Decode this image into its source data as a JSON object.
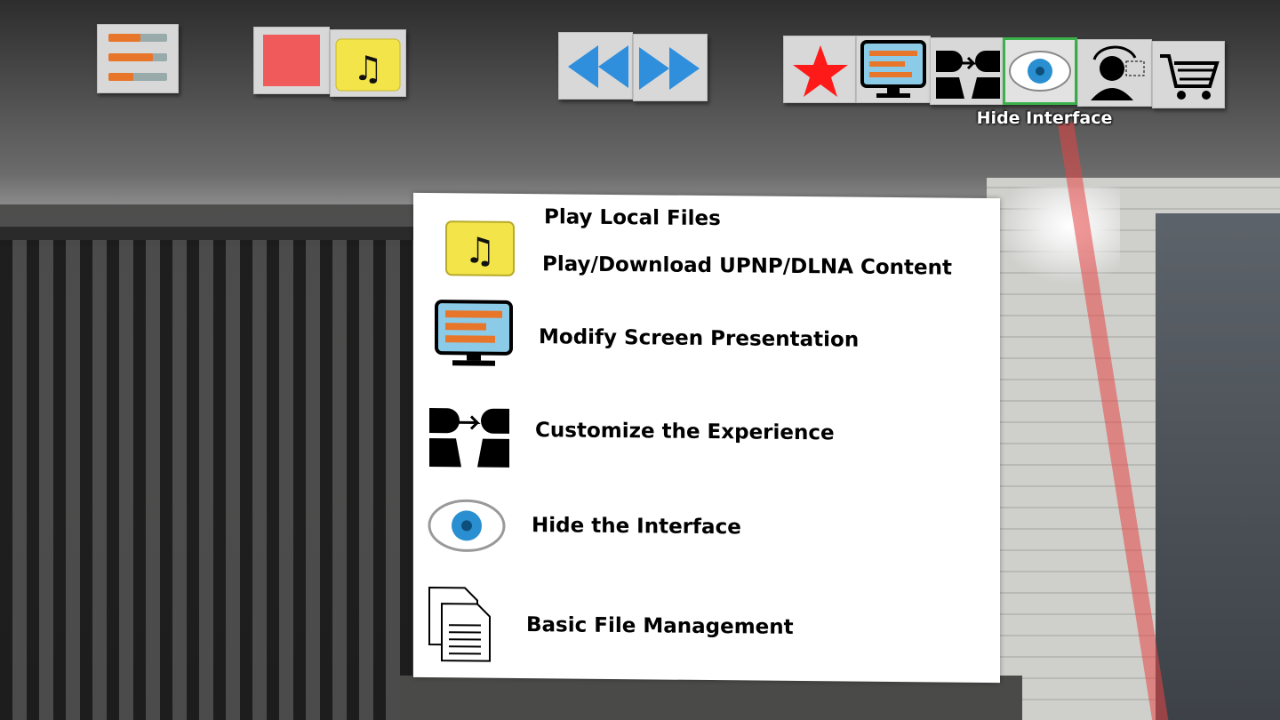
{
  "toolbar": {
    "buttons": [
      {
        "id": "settings",
        "icon": "sliders-icon"
      },
      {
        "id": "stop",
        "icon": "stop-square-icon",
        "color": "#f05a5a"
      },
      {
        "id": "music",
        "icon": "music-folder-icon",
        "color": "#f3e44a"
      },
      {
        "id": "rewind",
        "icon": "rewind-icon",
        "color": "#2f8fdc"
      },
      {
        "id": "fast-forward",
        "icon": "fast-forward-icon",
        "color": "#2f8fdc"
      },
      {
        "id": "favorite",
        "icon": "star-icon",
        "color": "#ff1a1a"
      },
      {
        "id": "screen",
        "icon": "screen-settings-icon"
      },
      {
        "id": "customize",
        "icon": "customize-experience-icon"
      },
      {
        "id": "hide",
        "icon": "eye-icon",
        "selected": true,
        "accent": "#3bb04b"
      },
      {
        "id": "rotate-user",
        "icon": "user-rotate-icon"
      },
      {
        "id": "cart",
        "icon": "shopping-cart-icon"
      }
    ],
    "tooltip": "Hide Interface"
  },
  "help_panel": {
    "items": [
      {
        "icon": "music-folder-icon",
        "label": "Play Local Files"
      },
      {
        "icon": "music-folder-icon",
        "label": "Play/Download UPNP/DLNA Content"
      },
      {
        "icon": "screen-settings-icon",
        "label": "Modify Screen Presentation"
      },
      {
        "icon": "customize-experience-icon",
        "label": "Customize the Experience"
      },
      {
        "icon": "eye-icon",
        "label": "Hide the Interface"
      },
      {
        "icon": "documents-icon",
        "label": "Basic File Management"
      }
    ]
  }
}
